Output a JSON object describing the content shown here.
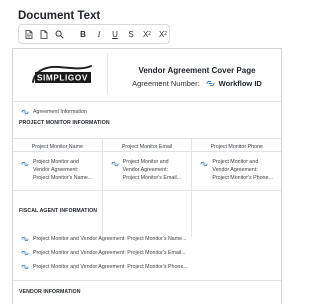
{
  "editor": {
    "title": "Document Text",
    "toolbar": {
      "left": [
        {
          "name": "document-icon",
          "label": ""
        },
        {
          "name": "page-icon",
          "label": ""
        },
        {
          "name": "search-icon",
          "label": ""
        }
      ],
      "format": [
        "B",
        "I",
        "U",
        "S",
        "X",
        "X"
      ],
      "format_sub": [
        "",
        "",
        "",
        "",
        "2",
        "2"
      ],
      "colors": {
        "border": "#d6d9dd",
        "icon": "#2b2f33"
      }
    }
  },
  "document": {
    "logo_text": "SIMPLIGOV",
    "cover_title": "Vendor Agreement Cover Page",
    "agreement_number_label": "Agreement Number:",
    "workflow_id": "Workflow ID",
    "agreement_info_label": "Agreement Information",
    "project_monitor": {
      "heading": "PROJECT MONITOR INFORMATION",
      "columns": [
        {
          "title": "Project Monitor Name",
          "body": [
            "Project Monitor and",
            "Vendor Agreement:",
            "Project Monitor's Name..."
          ]
        },
        {
          "title": "Project Monitor Email",
          "body": [
            "Project Monitor and",
            "Vendor Agreement:",
            "Project Monitor's Email..."
          ]
        },
        {
          "title": "Project Monitor Phone",
          "body": [
            "Project Monitor and",
            "Vendor Agreement:",
            "Project Monitor's Phone..."
          ]
        }
      ]
    },
    "fiscal_agent": {
      "heading": "FISCAL AGENT INFORMATION",
      "rows": [
        "Project Monitor and Vendor Agreement: Project Monitor's Name...",
        "Project Monitor and Vendor Agreement: Project Monitor's Email...",
        "Project Monitor and Vendor Agreement: Project Monitor's Phone..."
      ]
    },
    "vendor": {
      "heading": "VENDOR INFORMATION"
    },
    "colors": {
      "accent": "#2b6cb0",
      "border": "#d2d5d9",
      "divider": "#e1e3e6",
      "text": "#3a3f45"
    }
  }
}
